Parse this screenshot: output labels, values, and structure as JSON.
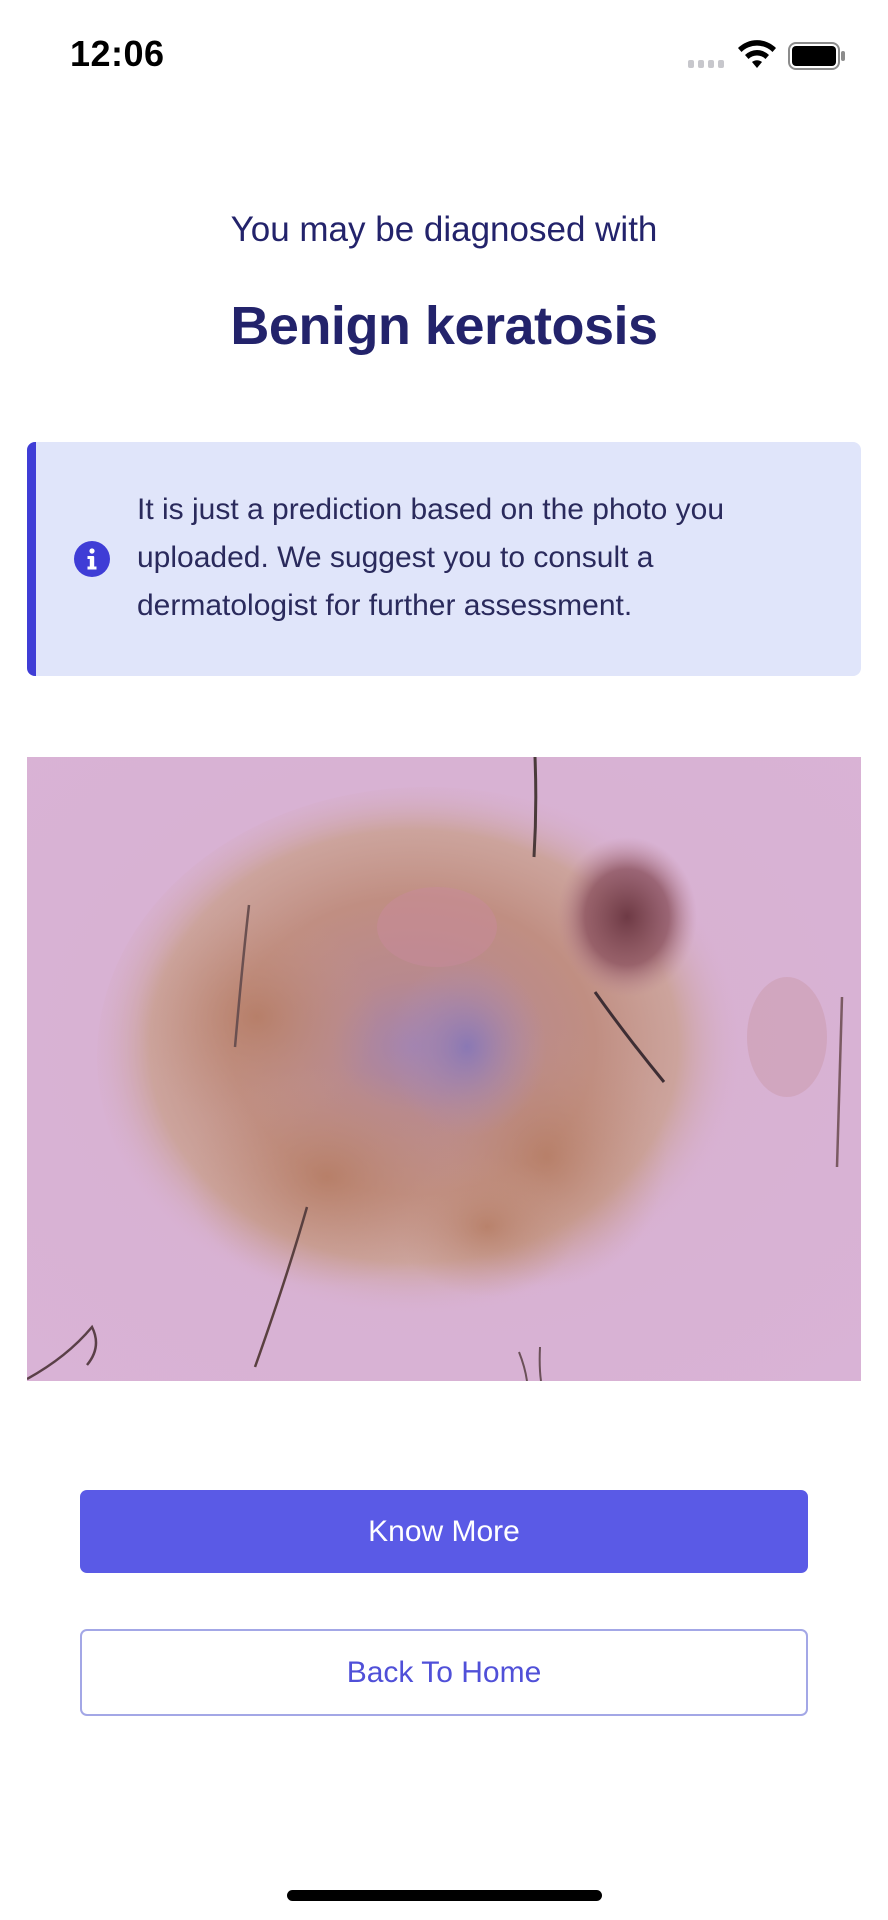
{
  "status_bar": {
    "time": "12:06",
    "icons": [
      "cellular-signal-icon",
      "wifi-icon",
      "battery-icon"
    ]
  },
  "result": {
    "subtitle": "You may be diagnosed with",
    "diagnosis": "Benign keratosis"
  },
  "notice": {
    "icon": "info-icon",
    "text": "It is just a prediction based on the photo you uploaded. We suggest you to consult a dermatologist for further assessment."
  },
  "image": {
    "description_icon": "uploaded-skin-photo"
  },
  "actions": {
    "know_more_label": "Know More",
    "back_home_label": "Back To Home"
  },
  "colors": {
    "primary": "#5a5ae6",
    "heading": "#23236b",
    "notice_bg": "#e0e5fa",
    "notice_accent": "#3f3dd6"
  }
}
